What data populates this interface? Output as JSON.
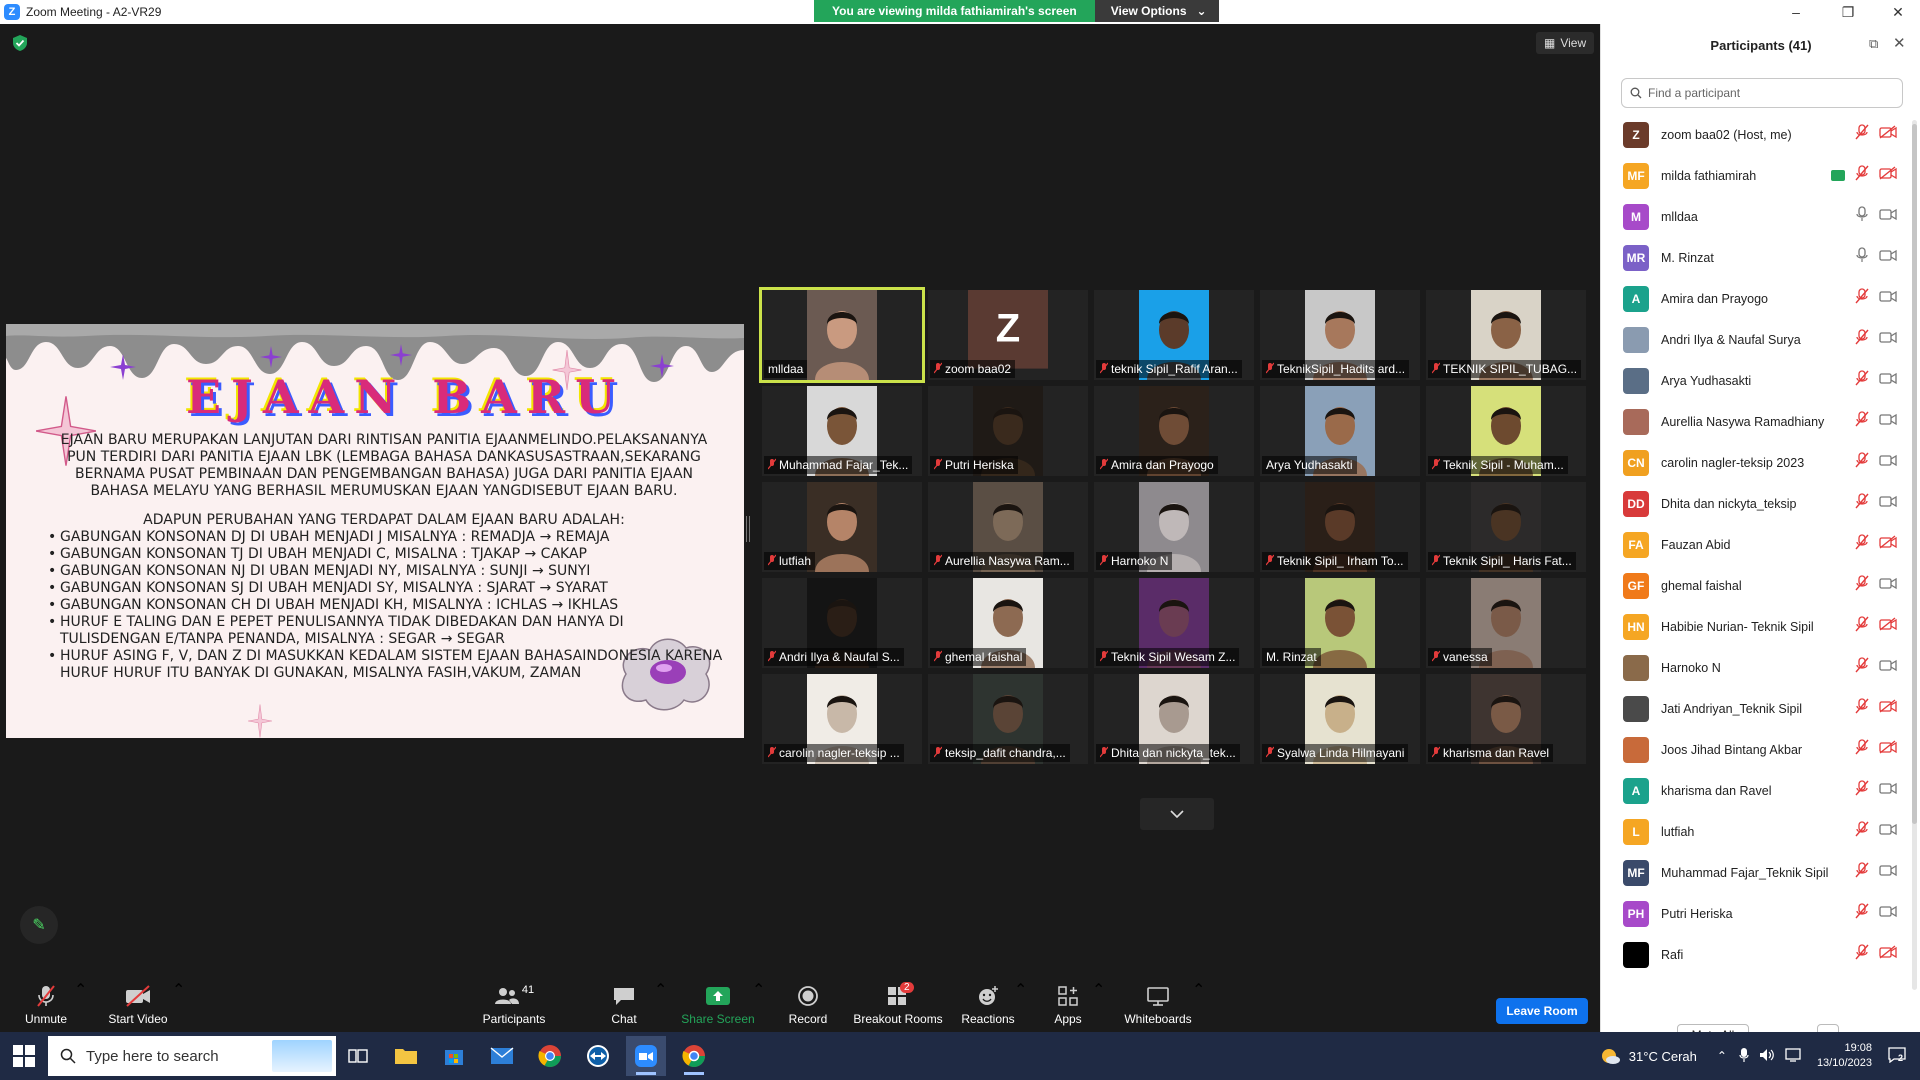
{
  "window": {
    "title": "Zoom Meeting - A2-VR29",
    "logo_letter": "Z",
    "controls": {
      "minimize": "–",
      "restore": "❐",
      "close": "✕"
    }
  },
  "banner": {
    "message": "You are viewing milda fathiamirah's screen",
    "options_label": "View Options"
  },
  "view_button": {
    "label": "View"
  },
  "slide": {
    "title": "EJAAN BARU",
    "paragraph1": "Ejaan baru merupakan lanjutan dari rintisan panitia ejaanmelindo.pelaksananya pun terdiri dari panitia ejaan LBK (lembaga bahasa dankasusastraan,sekarang bernama pusat pembinaan dan pengembangan bahasa) juga dari panitia ejaan bahasa melayu yang berhasil merumuskan ejaan yangdisebut ejaan baru.",
    "subhead": "Adapun perubahan yang terdapat dalam ejaan baru adalah:",
    "bullets": [
      "Gabungan konsonan dj di ubah menjadi j misalnya : remadja → remaja",
      "gabungan konsonan tj di ubah menjadi c, misalna : tjakap → cakap",
      "Gabungan konsonan nj di uban menjadi ny, misalnya : sunji → sunyi",
      "Gabungan konsonan sj di ubah menjadi sy, misalnya : sjarat → syarat",
      "Gabungan konsonan ch di ubah menjadi kh, misalnya : ichlas → ikhlas",
      "huruf e taling dan e pepet penulisannya tidak dibedakan dan hanya di tulisdengan e/tanpa penanda, misalnya : segar → segar",
      "Huruf asing f, v, dan z di masukkan kedalam sistem ejaan bahasaindonesia karena huruf huruf itu banyak di gunakan, misalnya fasih,vakum, zaman"
    ]
  },
  "gallery": {
    "tiles": [
      {
        "name": "mlldaa",
        "muted": false,
        "active": true,
        "skin": "#c99a80",
        "bg": "#6b5a52"
      },
      {
        "name": "zoom baa02",
        "muted": true,
        "letter": "Z"
      },
      {
        "name": "teknik Sipil_Rafif Aran...",
        "muted": true,
        "skin": "#5b3b2a",
        "bg": "#1aa0e8"
      },
      {
        "name": "TeknikSipil_Hadits ard...",
        "muted": true,
        "skin": "#a7785c",
        "bg": "#c8c8c8"
      },
      {
        "name": "TEKNIK SIPIL_TUBAG...",
        "muted": true,
        "skin": "#8a6246",
        "bg": "#d9d3c7"
      },
      {
        "name": "Muhammad Fajar_Tek...",
        "muted": true,
        "skin": "#7a5538",
        "bg": "#d8d8d8"
      },
      {
        "name": "Putri Heriska",
        "muted": true,
        "skin": "#3a2a1d",
        "bg": "#1f1a16"
      },
      {
        "name": "Amira dan Prayogo",
        "muted": true,
        "skin": "#6f4c36",
        "bg": "#2b211a"
      },
      {
        "name": "Arya Yudhasakti",
        "muted": false,
        "skin": "#9a6a4a",
        "bg": "#8aa0b8"
      },
      {
        "name": "Teknik Sipil - Muham...",
        "muted": true,
        "skin": "#6d4a2f",
        "bg": "#d6e07a"
      },
      {
        "name": "lutfiah",
        "muted": true,
        "skin": "#b58468",
        "bg": "#3a2e25"
      },
      {
        "name": "Aurellia Nasywa Ram...",
        "muted": true,
        "skin": "#7d6a58",
        "bg": "#5a4e44"
      },
      {
        "name": "Harnoko N",
        "muted": true,
        "skin": "#bfb8b8",
        "bg": "#8e8a8e"
      },
      {
        "name": "Teknik Sipil_ Irham To...",
        "muted": true,
        "skin": "#5a3a28",
        "bg": "#2a1f18"
      },
      {
        "name": "Teknik Sipil_ Haris Fat...",
        "muted": true,
        "skin": "#4a3423",
        "bg": "#2c2a2a"
      },
      {
        "name": "Andri Ilya & Naufal S...",
        "muted": true,
        "skin": "#2a1e16",
        "bg": "#141414"
      },
      {
        "name": "ghemal faishal",
        "muted": true,
        "skin": "#8d6a52",
        "bg": "#e8e6e2"
      },
      {
        "name": "Teknik Sipil Wesam Z...",
        "muted": true,
        "skin": "#6a3c52",
        "bg": "#5a2c68"
      },
      {
        "name": "M. Rinzat",
        "muted": false,
        "skin": "#7a5236",
        "bg": "#b8c87a"
      },
      {
        "name": "vanessa",
        "muted": true,
        "skin": "#7a5a48",
        "bg": "#8a7c74"
      },
      {
        "name": "carolin nagler-teksip ...",
        "muted": true,
        "skin": "#c8b8a8",
        "bg": "#f0ece6"
      },
      {
        "name": "teksip_dafit chandra,...",
        "muted": true,
        "skin": "#5a4436",
        "bg": "#2e3430"
      },
      {
        "name": "Dhita dan nickyta_tek...",
        "muted": true,
        "skin": "#a89a90",
        "bg": "#ddd6cf"
      },
      {
        "name": "Syalwa Linda Hilmayani",
        "muted": true,
        "skin": "#c8b08a",
        "bg": "#e6e2d0"
      },
      {
        "name": "kharisma dan Ravel",
        "muted": true,
        "skin": "#7a5a46",
        "bg": "#3e3430"
      }
    ]
  },
  "toolbar": {
    "unmute": "Unmute",
    "start_video": "Start Video",
    "participants": "Participants",
    "participants_count": "41",
    "chat": "Chat",
    "share_screen": "Share Screen",
    "record": "Record",
    "breakout_rooms": "Breakout Rooms",
    "breakout_badge": "2",
    "reactions": "Reactions",
    "apps": "Apps",
    "whiteboards": "Whiteboards",
    "leave": "Leave Room"
  },
  "panel": {
    "title": "Participants (41)",
    "search_placeholder": "Find a participant",
    "mute_all": "Mute All",
    "more": "···",
    "participants": [
      {
        "initials": "Z",
        "color": "#6b3b2a",
        "name": "zoom baa02 (Host, me)",
        "mic": "muted",
        "cam": "off"
      },
      {
        "initials": "MF",
        "color": "#f5a623",
        "name": "milda fathiamirah",
        "mic": "muted",
        "cam": "off",
        "sharing": true
      },
      {
        "initials": "M",
        "color": "#a74ac9",
        "name": "mlldaa",
        "mic": "on",
        "cam": "on"
      },
      {
        "initials": "MR",
        "color": "#7b61c7",
        "name": "M. Rinzat",
        "mic": "on",
        "cam": "on"
      },
      {
        "initials": "A",
        "color": "#1ba28c",
        "name": "Amira dan Prayogo",
        "mic": "muted",
        "cam": "on"
      },
      {
        "initials": "",
        "color": "#8a9bb0",
        "name": "Andri Ilya & Naufal Surya",
        "mic": "muted",
        "cam": "on"
      },
      {
        "initials": "",
        "color": "#5a6e86",
        "name": "Arya Yudhasakti",
        "mic": "muted",
        "cam": "on"
      },
      {
        "initials": "",
        "color": "#a86a5a",
        "name": "Aurellia Nasywa Ramadhiany",
        "mic": "muted",
        "cam": "on"
      },
      {
        "initials": "CN",
        "color": "#f0a020",
        "name": "carolin nagler-teksip 2023",
        "mic": "muted",
        "cam": "on"
      },
      {
        "initials": "DD",
        "color": "#d83a3a",
        "name": "Dhita dan nickyta_teksip",
        "mic": "muted",
        "cam": "on"
      },
      {
        "initials": "FA",
        "color": "#f5a623",
        "name": "Fauzan Abid",
        "mic": "muted",
        "cam": "off"
      },
      {
        "initials": "GF",
        "color": "#f07a1a",
        "name": "ghemal faishal",
        "mic": "muted",
        "cam": "on"
      },
      {
        "initials": "HN",
        "color": "#f5a623",
        "name": "Habibie Nurian- Teknik Sipil",
        "mic": "muted",
        "cam": "off"
      },
      {
        "initials": "",
        "color": "#8a6a4a",
        "name": "Harnoko N",
        "mic": "muted",
        "cam": "on"
      },
      {
        "initials": "",
        "color": "#4a4a4a",
        "name": "Jati Andriyan_Teknik Sipil",
        "mic": "muted",
        "cam": "off"
      },
      {
        "initials": "",
        "color": "#c86a3a",
        "name": "Joos Jihad Bintang Akbar",
        "mic": "muted",
        "cam": "off"
      },
      {
        "initials": "A",
        "color": "#1ba28c",
        "name": "kharisma dan Ravel",
        "mic": "muted",
        "cam": "on"
      },
      {
        "initials": "L",
        "color": "#f5a623",
        "name": "lutfiah",
        "mic": "muted",
        "cam": "on"
      },
      {
        "initials": "MF",
        "color": "#3a4a6a",
        "name": "Muhammad Fajar_Teknik Sipil",
        "mic": "muted",
        "cam": "on"
      },
      {
        "initials": "PH",
        "color": "#a74ac9",
        "name": "Putri Heriska",
        "mic": "muted",
        "cam": "on"
      },
      {
        "initials": "",
        "color": "#000000",
        "name": "Rafi",
        "mic": "muted",
        "cam": "off"
      }
    ]
  },
  "taskbar": {
    "search_placeholder": "Type here to search",
    "weather": "31°C  Cerah",
    "time": "19:08",
    "date": "13/10/2023",
    "notifications": "2"
  },
  "colors": {
    "accent": "#0e72ed",
    "share_green": "#23a55a",
    "muted_red": "#e33b3b",
    "active_speaker": "#cbe24a"
  }
}
